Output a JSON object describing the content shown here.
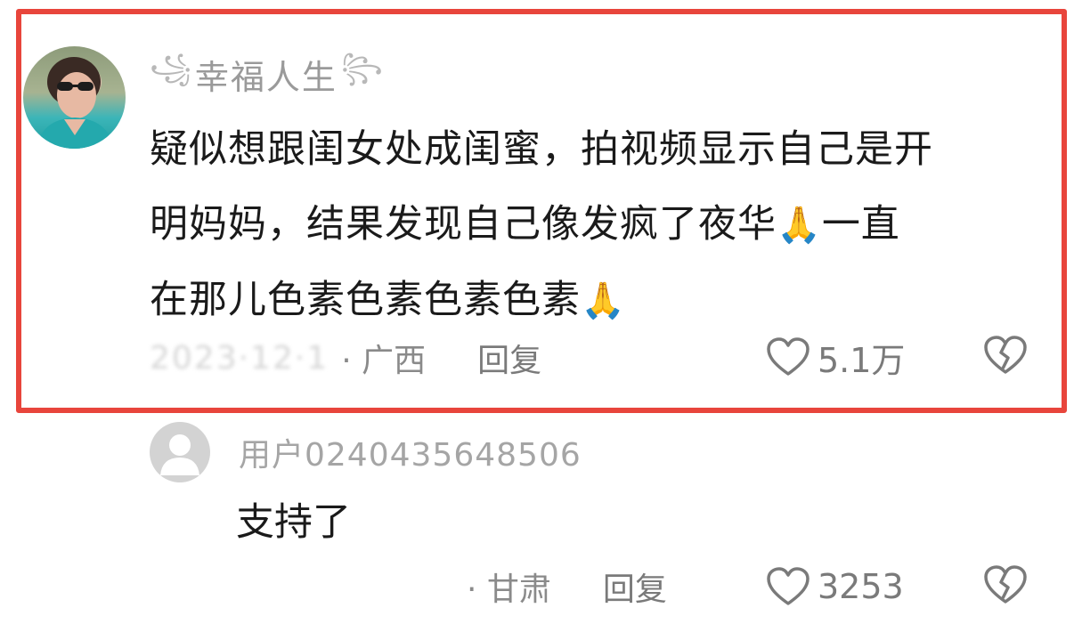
{
  "main_comment": {
    "username": "幸福人生",
    "text_line1": "疑似想跟闺女处成闺蜜，拍视频显示自己是开",
    "text_line2a": "明妈妈，结果发现自己像发疯了夜华",
    "text_line2b": "一直",
    "text_line3": "在那儿色素色素色素色素",
    "emoji": "🙏",
    "date_blurred": "2023·12·1",
    "location": "· 广西",
    "reply_label": "回复",
    "likes": "5.1万",
    "highlight_color": "#e8453c"
  },
  "reply_comment": {
    "username": "用户0240435648506",
    "text": "支持了",
    "location": "· 甘肃",
    "reply_label": "回复",
    "likes": "3253"
  }
}
